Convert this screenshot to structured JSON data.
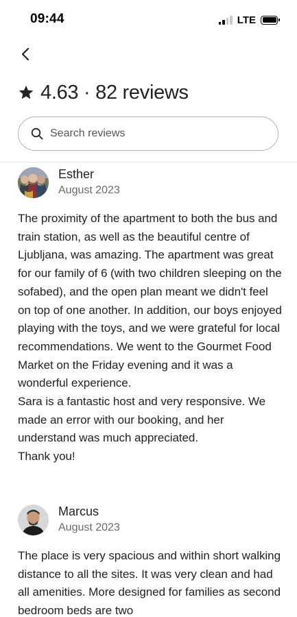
{
  "status_bar": {
    "time": "09:44",
    "network": "LTE",
    "icons": [
      "signal-icon",
      "battery-icon"
    ]
  },
  "nav": {
    "back_icon": "chevron-left-icon"
  },
  "header": {
    "rating": "4.63",
    "separator": "·",
    "reviews_count": "82 reviews",
    "star_icon": "star-icon"
  },
  "search": {
    "placeholder": "Search reviews",
    "value": "",
    "icon": "search-icon"
  },
  "reviews": [
    {
      "name": "Esther",
      "date": "August 2023",
      "text": "The proximity of the apartment to both the bus and train station, as well as the beautiful centre of Ljubljana, was amazing. The apartment was great for our family of 6 (with two children sleeping on the sofabed), and the open plan meant we didn't feel on top of one another. In addition, our boys enjoyed playing with the toys, and we were grateful for local recommendations. We went to the Gourmet Food Market on the Friday evening and it was a wonderful experience.\nSara is a fantastic host and very responsive. We made an error with our booking, and her understand was much appreciated.\nThank you!"
    },
    {
      "name": "Marcus",
      "date": "August 2023",
      "text": "The place is very spacious and within short walking distance to all the sites. It was very clean and had all amenities. More designed for families as second bedroom beds are two"
    }
  ],
  "colors": {
    "text": "#222222",
    "muted": "#6a6a6a",
    "border": "#b0b0b0",
    "background": "#ffffff"
  }
}
